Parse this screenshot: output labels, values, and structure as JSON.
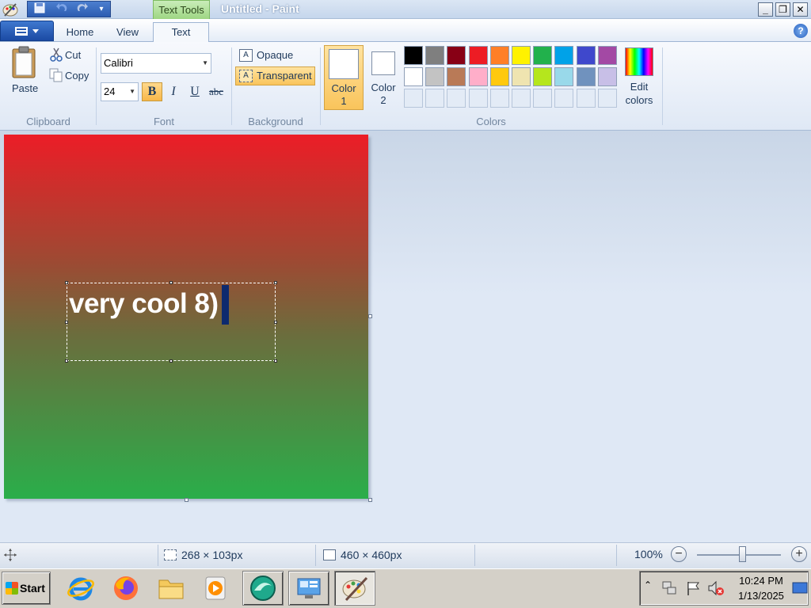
{
  "window": {
    "title": "Untitled - Paint",
    "context_tab": "Text Tools"
  },
  "ribbon_tabs": [
    "Home",
    "View",
    "Text"
  ],
  "clipboard": {
    "paste": "Paste",
    "cut": "Cut",
    "copy": "Copy",
    "label": "Clipboard"
  },
  "font": {
    "family": "Calibri",
    "size": "24",
    "bold": "B",
    "italic": "I",
    "underline": "U",
    "strike": "abc",
    "label": "Font"
  },
  "background": {
    "opaque": "Opaque",
    "transparent": "Transparent",
    "label": "Background"
  },
  "colors": {
    "color1": "Color 1",
    "color2": "Color 2",
    "edit": "Edit colors",
    "label": "Colors",
    "color1_value": "#ffffff",
    "color2_value": "#ffffff",
    "row1": [
      "#000000",
      "#7f7f7f",
      "#880015",
      "#ed1c24",
      "#ff7f27",
      "#fff200",
      "#22b14c",
      "#00a2e8",
      "#3f48cc",
      "#a349a4"
    ],
    "row2": [
      "#ffffff",
      "#c3c3c3",
      "#b97a57",
      "#ffaec9",
      "#ffc90e",
      "#efe4b0",
      "#b5e61d",
      "#99d9ea",
      "#7092be",
      "#c8bfe7"
    ]
  },
  "canvas": {
    "text": "very cool 8)",
    "gradient_top": "#ec1d27",
    "gradient_bottom": "#2aae4a"
  },
  "status": {
    "selection_size": "268 × 103px",
    "canvas_size": "460 × 460px",
    "zoom": "100%"
  },
  "taskbar": {
    "start": "Start",
    "time": "10:24 PM",
    "date": "1/13/2025"
  }
}
